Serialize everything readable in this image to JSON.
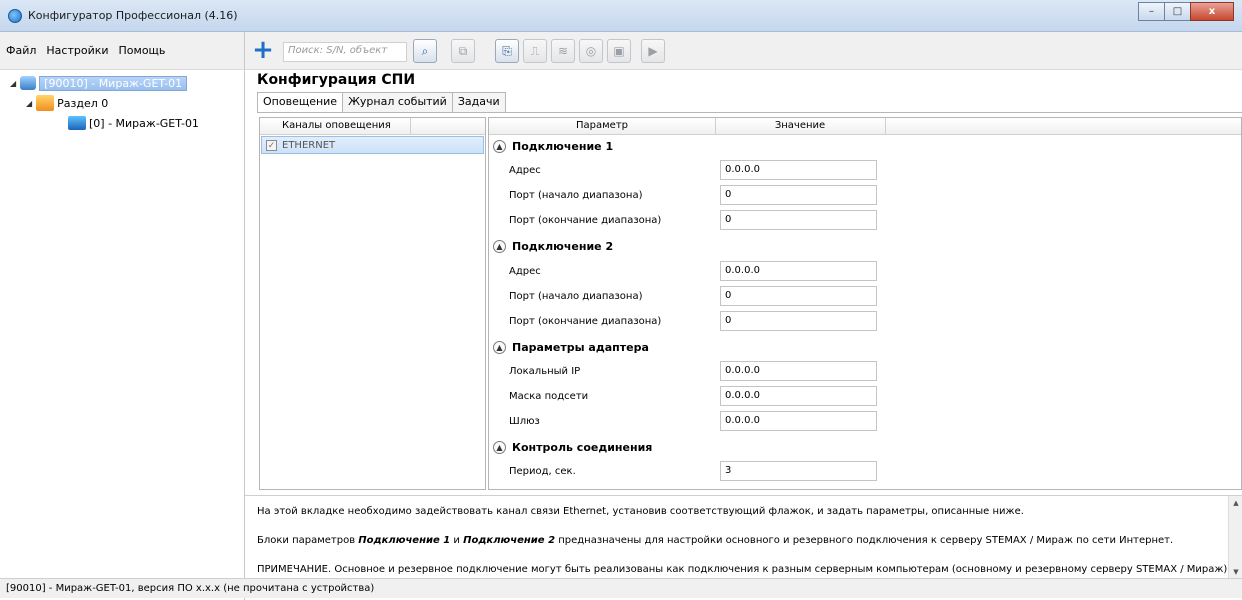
{
  "window": {
    "title": "Конфигуратор Профессионал (4.16)",
    "buttons": {
      "minimize": "–",
      "maximize": "□",
      "close": "x"
    }
  },
  "menu": {
    "items": [
      "Файл",
      "Настройки",
      "Помощь"
    ]
  },
  "toolbar": {
    "search_placeholder": "Поиск: S/N, объект"
  },
  "tree": {
    "items": [
      {
        "label": "[90010] - Мираж-GET-01",
        "level": 0,
        "selected": true
      },
      {
        "label": "Раздел 0",
        "level": 1
      },
      {
        "label": "[0] - Мираж-GET-01",
        "level": 2
      }
    ]
  },
  "main": {
    "title": "Конфигурация СПИ",
    "tabs": [
      {
        "label": "Оповещение",
        "active": true
      },
      {
        "label": "Журнал событий"
      },
      {
        "label": "Задачи"
      }
    ]
  },
  "channels": {
    "header": "Каналы оповещения",
    "rows": [
      {
        "label": "ETHERNET",
        "checked": true
      }
    ]
  },
  "params": {
    "header_param": "Параметр",
    "header_value": "Значение",
    "groups": [
      {
        "title": "Подключение 1",
        "rows": [
          {
            "label": "Адрес",
            "value": "0.0.0.0"
          },
          {
            "label": "Порт (начало диапазона)",
            "value": "0"
          },
          {
            "label": "Порт (окончание диапазона)",
            "value": "0"
          }
        ]
      },
      {
        "title": "Подключение 2",
        "rows": [
          {
            "label": "Адрес",
            "value": "0.0.0.0"
          },
          {
            "label": "Порт (начало диапазона)",
            "value": "0"
          },
          {
            "label": "Порт (окончание диапазона)",
            "value": "0"
          }
        ]
      },
      {
        "title": "Параметры адаптера",
        "rows": [
          {
            "label": "Локальный IP",
            "value": "0.0.0.0"
          },
          {
            "label": "Маска подсети",
            "value": "0.0.0.0"
          },
          {
            "label": "Шлюз",
            "value": "0.0.0.0"
          }
        ]
      },
      {
        "title": "Контроль соединения",
        "rows": [
          {
            "label": "Период, сек.",
            "value": "3"
          }
        ]
      }
    ]
  },
  "description": {
    "p1": "На этой вкладке необходимо задействовать канал связи Ethernet, установив соответствующий флажок, и задать параметры, описанные ниже.",
    "p2_pre": "Блоки параметров ",
    "p2_b1": "Подключение 1",
    "p2_mid": " и ",
    "p2_b2": "Подключение 2",
    "p2_post": " предназначены для настройки основного и резервного подключения к серверу STEMAX / Мираж по сети Интернет.",
    "p3": "ПРИМЕЧАНИЕ. Основное и резервное подключение могут быть реализованы как подключения к разным серверным компьютерам (основному и резервному серверу STEMAX / Мираж) или"
  },
  "status": {
    "text": "[90010] - Мираж-GET-01, версия ПО x.x.x (не прочитана с устройства)"
  }
}
